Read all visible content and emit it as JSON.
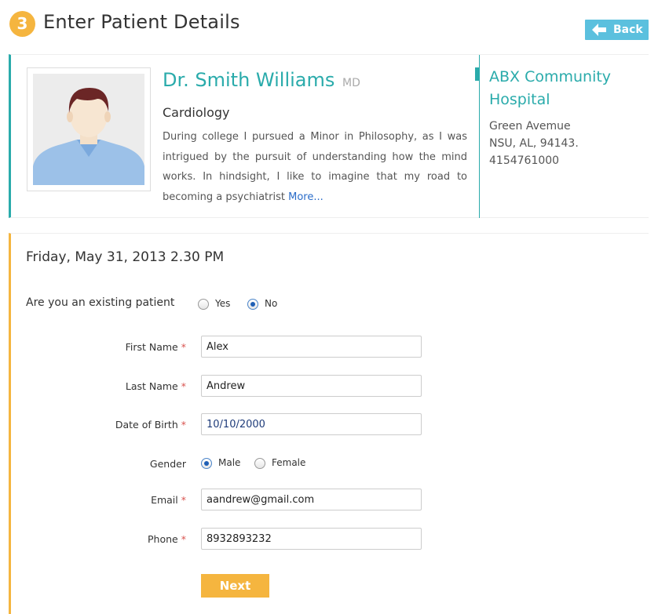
{
  "header": {
    "step_number": "3",
    "title": "Enter Patient Details",
    "back_label": "Back"
  },
  "doctor": {
    "name": "Dr. Smith Williams",
    "suffix": "MD",
    "specialty": "Cardiology",
    "bio": "During college I pursued a Minor in Philosophy, as I was intrigued by the pursuit of understanding how the mind works. In hindsight, I like to imagine that my road to becoming a psychiatrist",
    "more_link": "More..."
  },
  "hospital": {
    "name": "ABX Community Hospital",
    "address_line1": "Green Avemue",
    "address_line2": "NSU, AL, 94143.",
    "phone": "4154761000"
  },
  "appointment": {
    "datetime": "Friday, May 31, 2013 2.30 PM"
  },
  "existing_patient": {
    "question": "Are you an existing patient",
    "options": [
      "Yes",
      "No"
    ],
    "selected": "No"
  },
  "form": {
    "first_name": {
      "label": "First Name",
      "required": "*",
      "value": "Alex"
    },
    "last_name": {
      "label": "Last Name",
      "required": "*",
      "value": "Andrew"
    },
    "dob": {
      "label": "Date of Birth",
      "required": "*",
      "value": "10/10/2000"
    },
    "gender": {
      "label": "Gender",
      "options": [
        "Male",
        "Female"
      ],
      "selected": "Male"
    },
    "email": {
      "label": "Email",
      "required": "*",
      "value": "aandrew@gmail.com"
    },
    "phone": {
      "label": "Phone",
      "required": "*",
      "value": "8932893232"
    }
  },
  "next_label": "Next",
  "colors": {
    "teal_accent": "#2aabab",
    "orange_accent": "#f5b53f",
    "back_button": "#5bc0de",
    "required_star": "#d9534f",
    "link": "#2a6cc9"
  },
  "icons": {
    "back": "arrow-left-icon",
    "step": "step-number-badge",
    "avatar": "doctor-avatar"
  }
}
